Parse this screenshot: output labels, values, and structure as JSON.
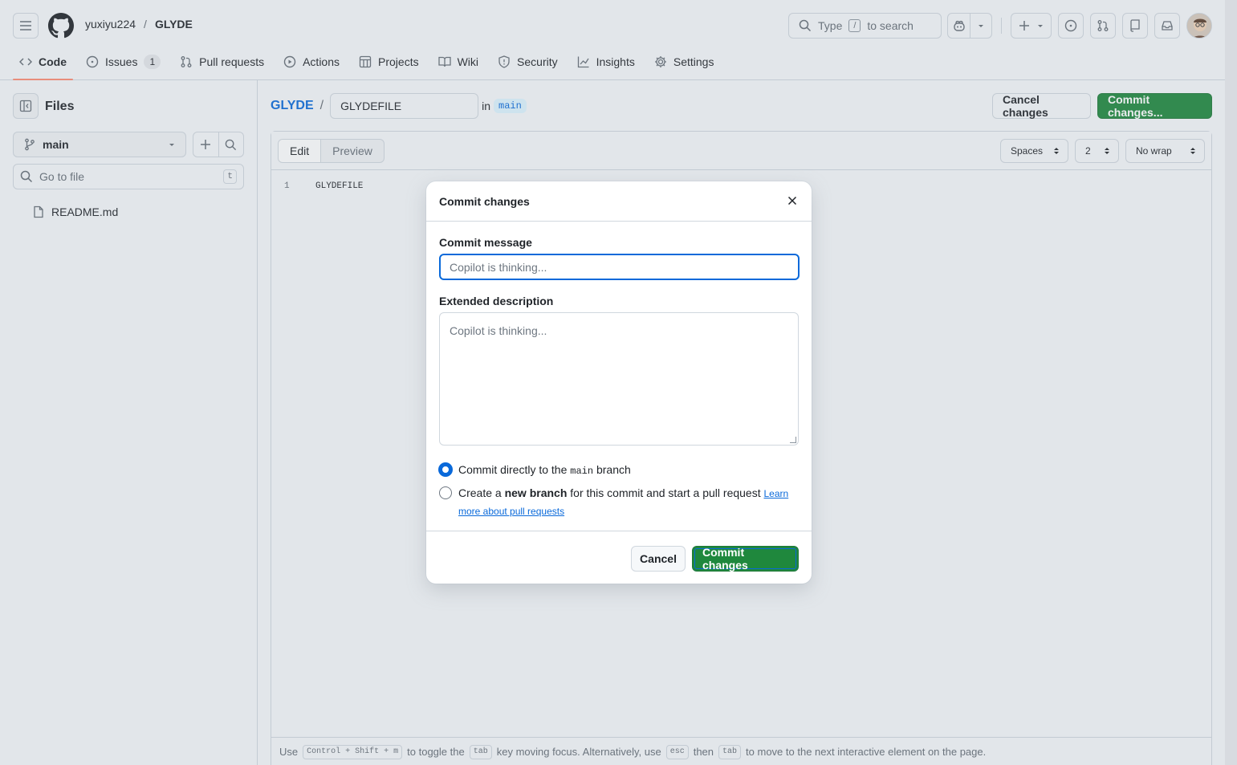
{
  "header": {
    "owner": "yuxiyu224",
    "separator": "/",
    "repo": "GLYDE",
    "search_prefix": "Type",
    "search_key": "/",
    "search_suffix": "to search"
  },
  "tabs": [
    {
      "label": "Code",
      "icon": "code-icon",
      "active": true
    },
    {
      "label": "Issues",
      "icon": "issue-opened-icon",
      "count": "1"
    },
    {
      "label": "Pull requests",
      "icon": "git-pull-request-icon"
    },
    {
      "label": "Actions",
      "icon": "play-icon"
    },
    {
      "label": "Projects",
      "icon": "table-icon"
    },
    {
      "label": "Wiki",
      "icon": "book-icon"
    },
    {
      "label": "Security",
      "icon": "shield-icon"
    },
    {
      "label": "Insights",
      "icon": "graph-icon"
    },
    {
      "label": "Settings",
      "icon": "gear-icon"
    }
  ],
  "sidebar": {
    "title": "Files",
    "branch": "main",
    "goto_placeholder": "Go to file",
    "goto_shortcut": "t",
    "files": [
      {
        "name": "README.md",
        "icon": "file-icon"
      }
    ]
  },
  "editor": {
    "repo_link": "GLYDE",
    "slash": "/",
    "filename": "GLYDEFILE",
    "in_label": "in",
    "branch": "main",
    "cancel_label": "Cancel changes",
    "commit_label": "Commit changes...",
    "mode_edit": "Edit",
    "mode_preview": "Preview",
    "indent_mode": "Spaces",
    "indent_size": "2",
    "wrap_mode": "No wrap",
    "lines": [
      {
        "number": "1",
        "text": "GLYDEFILE"
      }
    ],
    "hint": {
      "use": "Use",
      "shortcut": "Control + Shift + m",
      "to_toggle": "to toggle the",
      "tab_key": "tab",
      "key_moving": "key moving focus. Alternatively, use",
      "esc_key": "esc",
      "then": "then",
      "tab_key2": "tab",
      "to_move": "to move to the next interactive element on the page."
    }
  },
  "modal": {
    "title": "Commit changes",
    "message_label": "Commit message",
    "message_placeholder": "Copilot is thinking...",
    "description_label": "Extended description",
    "description_placeholder": "Copilot is thinking...",
    "option_direct_prefix": "Commit directly to the",
    "option_direct_branch": "main",
    "option_direct_suffix": "branch",
    "option_direct_selected": true,
    "option_new_prefix": "Create a",
    "option_new_bold": "new branch",
    "option_new_suffix": "for this commit and start a pull request",
    "option_new_link": "Learn more about pull requests",
    "option_new_selected": false,
    "cancel_label": "Cancel",
    "commit_label": "Commit changes"
  },
  "colors": {
    "primary_green": "#1f883d",
    "accent_blue": "#0969da",
    "active_tab_underline": "#fd8c73"
  }
}
